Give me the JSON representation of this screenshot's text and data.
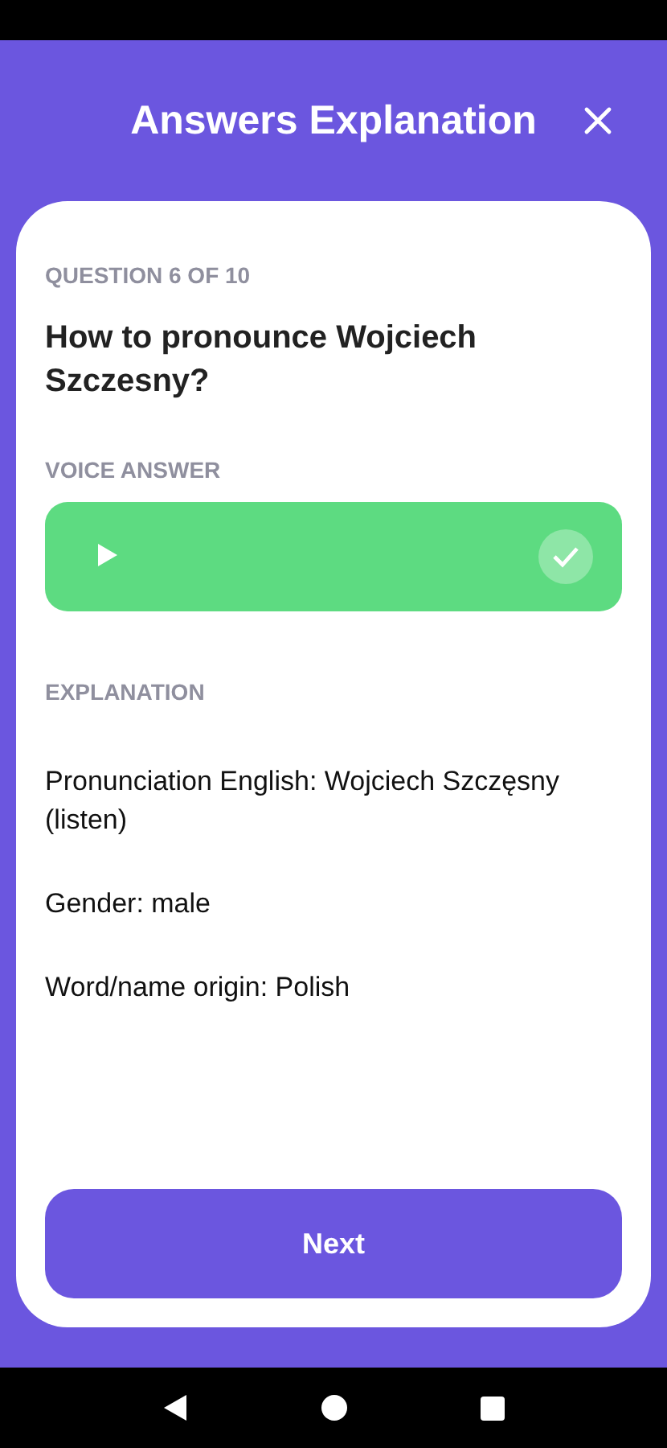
{
  "header": {
    "title": "Answers Explanation"
  },
  "question": {
    "counter": "QUESTION 6 OF 10",
    "text": "How to pronounce Wojciech Szczesny?"
  },
  "voice_answer": {
    "label": "VOICE ANSWER",
    "correct": true
  },
  "explanation": {
    "label": "EXPLANATION",
    "paragraphs": [
      "Pronunciation English: Wojciech Szczęsny (listen)",
      "Gender: male",
      "Word/name origin: Polish"
    ]
  },
  "next_button": {
    "label": "Next"
  }
}
